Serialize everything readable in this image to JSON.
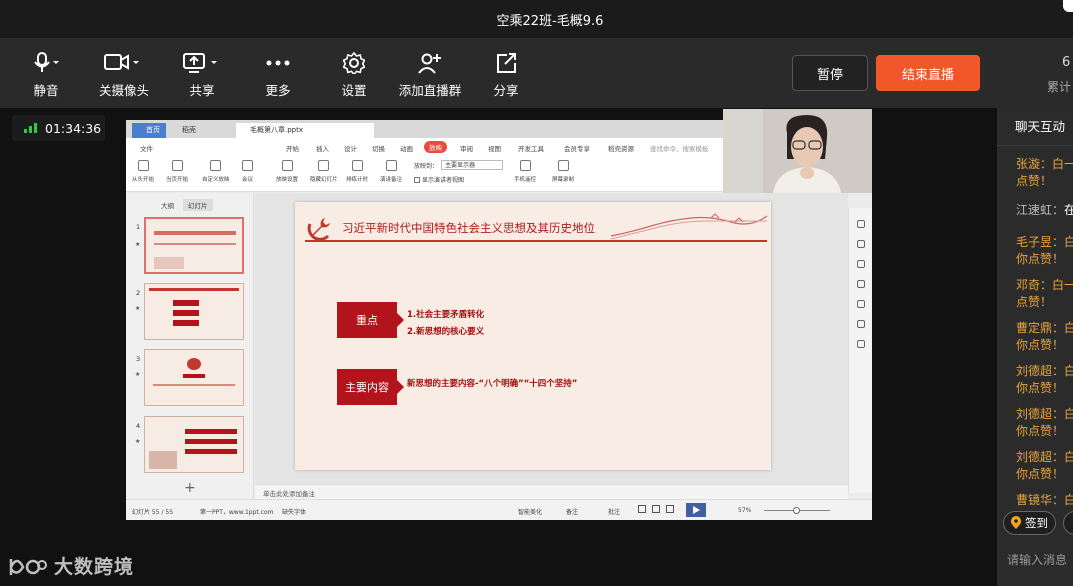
{
  "window": {
    "title": "空乘22班-毛概9.6"
  },
  "toolbar": {
    "items": [
      {
        "label": "静音",
        "icon": "microphone-icon"
      },
      {
        "label": "关摄像头",
        "icon": "camera-icon"
      },
      {
        "label": "共享",
        "icon": "share-screen-icon"
      },
      {
        "label": "更多",
        "icon": "more-icon"
      },
      {
        "label": "设置",
        "icon": "gear-icon"
      },
      {
        "label": "添加直播群",
        "icon": "add-group-icon"
      },
      {
        "label": "分享",
        "icon": "share-icon"
      }
    ],
    "pause_label": "暂停",
    "end_label": "结束直播",
    "stat_value": "6",
    "stat_label": "累计"
  },
  "timer": {
    "value": "01:34:36"
  },
  "brand": {
    "logo": "大数跨境"
  },
  "wps": {
    "tabs": [
      "首页",
      "稻壳",
      "毛概第八章.pptx"
    ],
    "menu": [
      "文件",
      "开始",
      "插入",
      "设计",
      "切换",
      "动画",
      "放映",
      "审阅",
      "视图",
      "开发工具",
      "会员专享",
      "稻壳资源",
      "查找命令、搜索模板"
    ],
    "active_menu": "放映",
    "ribbon": [
      "从头开始",
      "当页开始",
      "自定义放映",
      "会议",
      "放映设置",
      "隐藏幻灯片",
      "排练计时",
      "演讲备注",
      "手机遥控",
      "屏幕录制"
    ],
    "ribbon_select_label": "放映到：",
    "ribbon_select_value": "主要显示器",
    "ribbon_check_label": "显示演讲者视图",
    "panel_tabs": [
      "大纲",
      "幻灯片"
    ],
    "thumb_numbers": [
      "1",
      "2",
      "3",
      "4"
    ],
    "notes_placeholder": "单击此处添加备注",
    "status": {
      "slide_index": "幻灯片 55 / 55",
      "template": "第一PPT，www.1ppt.com",
      "missing_font": "缺失字体",
      "beautify": "智能美化",
      "notes": "备注",
      "comments": "批注",
      "zoom": "57%"
    }
  },
  "slide": {
    "title": "习近平新时代中国特色社会主义思想及其历史地位",
    "sections": [
      {
        "tag": "重点",
        "points": [
          "1.社会主要矛盾转化",
          "2.新思想的核心要义"
        ]
      },
      {
        "tag": "主要内容",
        "points": [
          "新思想的主要内容-“八个明确”“十四个坚持”"
        ]
      }
    ]
  },
  "chat": {
    "title": "聊天互动",
    "messages": [
      {
        "name": "张漩：",
        "text": "白一",
        "cont": "点赞！",
        "type": "like"
      },
      {
        "name": "江速虹：",
        "text": "在",
        "cont": "",
        "type": "sys"
      },
      {
        "name": "毛子昱：",
        "text": "白一",
        "cont": "你点赞！",
        "type": "like"
      },
      {
        "name": "邓奇：",
        "text": "白一",
        "cont": "点赞！",
        "type": "like"
      },
      {
        "name": "曹定鼎：",
        "text": "白",
        "cont": "你点赞！",
        "type": "like"
      },
      {
        "name": "刘德超：",
        "text": "白",
        "cont": "你点赞！",
        "type": "like"
      },
      {
        "name": "刘德超：",
        "text": "白",
        "cont": "你点赞！",
        "type": "like"
      },
      {
        "name": "刘德超：",
        "text": "白",
        "cont": "你点赞！",
        "type": "like"
      },
      {
        "name": "曹镜华：",
        "text": "白",
        "cont": "",
        "type": "like"
      }
    ],
    "sign_label": "签到",
    "input_placeholder": "请输入消息"
  },
  "colors": {
    "accent": "#f0582a",
    "slide_red": "#b3131a",
    "chat_name": "#e9a43b"
  }
}
